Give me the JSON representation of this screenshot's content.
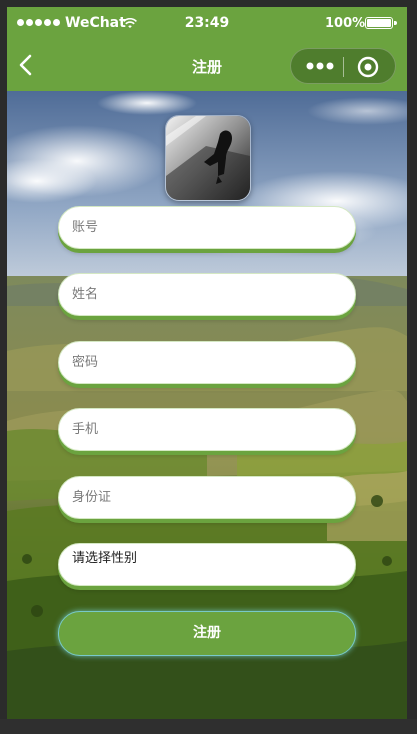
{
  "status_bar": {
    "carrier": "WeChat",
    "time": "23:49",
    "battery": "100%"
  },
  "nav": {
    "title": "注册",
    "back_icon": "chevron-left-icon",
    "more_icon": "more-dots-icon",
    "close_icon": "target-circle-icon"
  },
  "avatar": {
    "icon": "avatar-image"
  },
  "form": {
    "account_placeholder": "账号",
    "name_placeholder": "姓名",
    "password_placeholder": "密码",
    "phone_placeholder": "手机",
    "id_card_placeholder": "身份证",
    "gender_label": "请选择性别",
    "submit_label": "注册"
  },
  "colors": {
    "theme_green": "#6ba33f",
    "capsule": "#4f7d2d"
  }
}
